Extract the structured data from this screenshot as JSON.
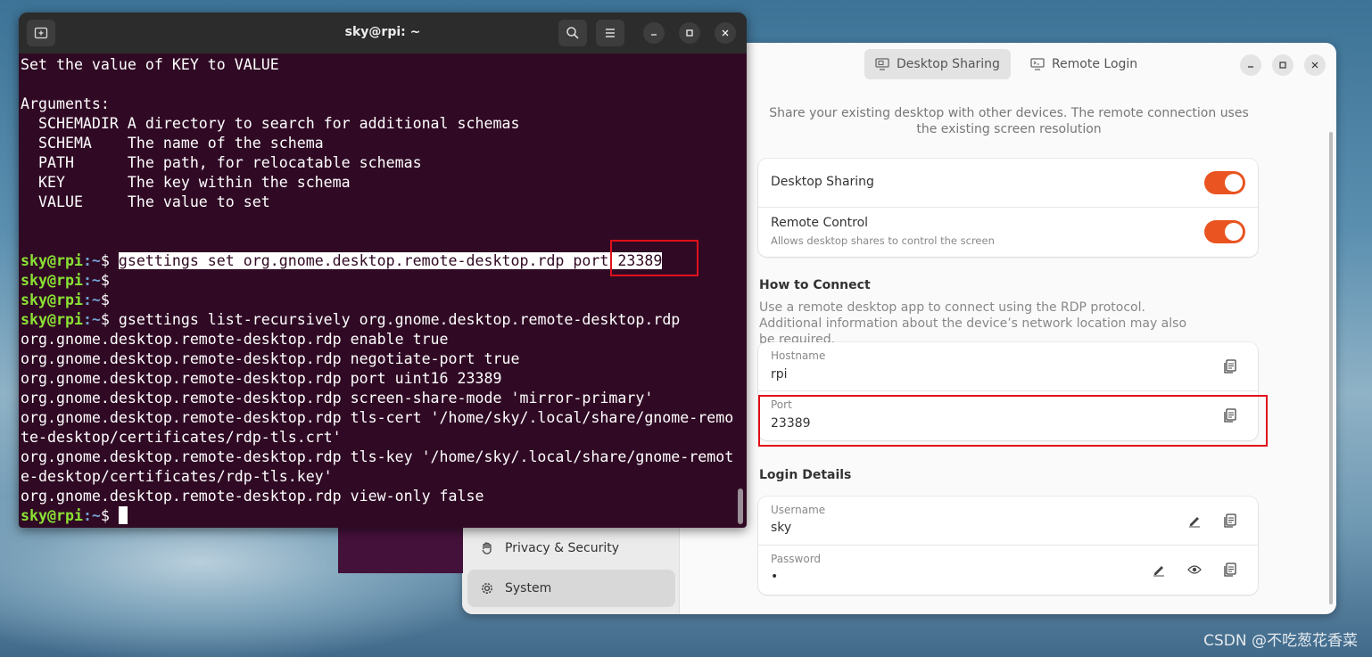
{
  "terminal": {
    "title": "sky@rpi: ~",
    "prompt_user": "sky@rpi",
    "prompt_path": ":~",
    "prompt_symbol": "$ ",
    "lines": [
      {
        "kind": "text",
        "text": "Set the value of KEY to VALUE"
      },
      {
        "kind": "text",
        "text": ""
      },
      {
        "kind": "text",
        "text": "Arguments:"
      },
      {
        "kind": "text",
        "text": "  SCHEMADIR A directory to search for additional schemas"
      },
      {
        "kind": "text",
        "text": "  SCHEMA    The name of the schema"
      },
      {
        "kind": "text",
        "text": "  PATH      The path, for relocatable schemas"
      },
      {
        "kind": "text",
        "text": "  KEY       The key within the schema"
      },
      {
        "kind": "text",
        "text": "  VALUE     The value to set"
      },
      {
        "kind": "text",
        "text": ""
      },
      {
        "kind": "text",
        "text": ""
      },
      {
        "kind": "prompt",
        "text": "gsettings set org.gnome.desktop.remote-desktop.rdp port 23389",
        "selected": true
      },
      {
        "kind": "prompt",
        "text": ""
      },
      {
        "kind": "prompt",
        "text": ""
      },
      {
        "kind": "prompt",
        "text": "gsettings list-recursively org.gnome.desktop.remote-desktop.rdp"
      },
      {
        "kind": "text",
        "text": "org.gnome.desktop.remote-desktop.rdp enable true"
      },
      {
        "kind": "text",
        "text": "org.gnome.desktop.remote-desktop.rdp negotiate-port true"
      },
      {
        "kind": "text",
        "text": "org.gnome.desktop.remote-desktop.rdp port uint16 23389"
      },
      {
        "kind": "text",
        "text": "org.gnome.desktop.remote-desktop.rdp screen-share-mode 'mirror-primary'"
      },
      {
        "kind": "text",
        "text": "org.gnome.desktop.remote-desktop.rdp tls-cert '/home/sky/.local/share/gnome-remo"
      },
      {
        "kind": "text",
        "text": "te-desktop/certificates/rdp-tls.crt'"
      },
      {
        "kind": "text",
        "text": "org.gnome.desktop.remote-desktop.rdp tls-key '/home/sky/.local/share/gnome-remot"
      },
      {
        "kind": "text",
        "text": "e-desktop/certificates/rdp-tls.key'"
      },
      {
        "kind": "text",
        "text": "org.gnome.desktop.remote-desktop.rdp view-only false"
      },
      {
        "kind": "prompt",
        "text": "",
        "cursor": true
      }
    ]
  },
  "settings": {
    "sidebar": {
      "items": [
        {
          "label": "Privacy & Security",
          "icon": "hand-icon"
        },
        {
          "label": "System",
          "icon": "gear-icon",
          "active": true
        }
      ]
    },
    "tabs": [
      {
        "label": "Desktop Sharing",
        "icon": "desktop-sharing-icon",
        "active": true
      },
      {
        "label": "Remote Login",
        "icon": "remote-login-icon"
      }
    ],
    "description": "Share your existing desktop with other devices. The remote connection uses the existing screen resolution",
    "sharing": {
      "desktop_sharing_label": "Desktop Sharing",
      "desktop_sharing_on": true,
      "remote_control_label": "Remote Control",
      "remote_control_sub": "Allows desktop shares to control the screen",
      "remote_control_on": true
    },
    "how_to_connect": {
      "title": "How to Connect",
      "description": "Use a remote desktop app to connect using the RDP protocol. Additional information about the device’s network location may also be required.",
      "hostname_label": "Hostname",
      "hostname_value": "rpi",
      "port_label": "Port",
      "port_value": "23389"
    },
    "login_details": {
      "title": "Login Details",
      "username_label": "Username",
      "username_value": "sky",
      "password_label": "Password",
      "password_value": "•"
    }
  },
  "watermark": "CSDN @不吃葱花香菜",
  "colors": {
    "terminal_bg": "#300a24",
    "accent": "#e95420",
    "highlight": "#e0101a",
    "prompt_user": "#8ae234",
    "prompt_path": "#729fcf"
  }
}
